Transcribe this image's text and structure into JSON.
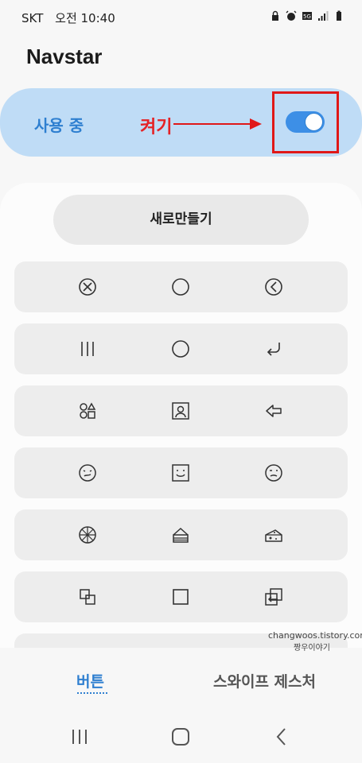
{
  "status_bar": {
    "carrier": "SKT",
    "time": "오전 10:40"
  },
  "app": {
    "title": "Navstar"
  },
  "toggle": {
    "label": "사용 중",
    "enabled": true,
    "annotation": "켜기"
  },
  "create_button": {
    "label": "새로만들기"
  },
  "button_sets": [
    {
      "icons": [
        "circle-x-icon",
        "circle-icon",
        "circle-back-icon"
      ]
    },
    {
      "icons": [
        "recents-icon",
        "circle-icon",
        "return-arrow-icon"
      ]
    },
    {
      "icons": [
        "shapes-icon",
        "portrait-icon",
        "arrow-left-icon"
      ]
    },
    {
      "icons": [
        "face-unsure-icon",
        "face-smile-square-icon",
        "face-wink-icon"
      ]
    },
    {
      "icons": [
        "pizza-icon",
        "cake-icon",
        "cheese-icon"
      ]
    },
    {
      "icons": [
        "overlap-squares-icon",
        "square-icon",
        "exit-box-icon"
      ]
    }
  ],
  "tabs": {
    "buttons": "버튼",
    "swipe": "스와이프 제스처"
  },
  "watermark": {
    "line1": "changwoos.tistory.com",
    "line2": "짱우이야기"
  },
  "colors": {
    "accent": "#2e7fd0",
    "highlight": "#e01818",
    "toggle_card": "#bfdcf6"
  }
}
